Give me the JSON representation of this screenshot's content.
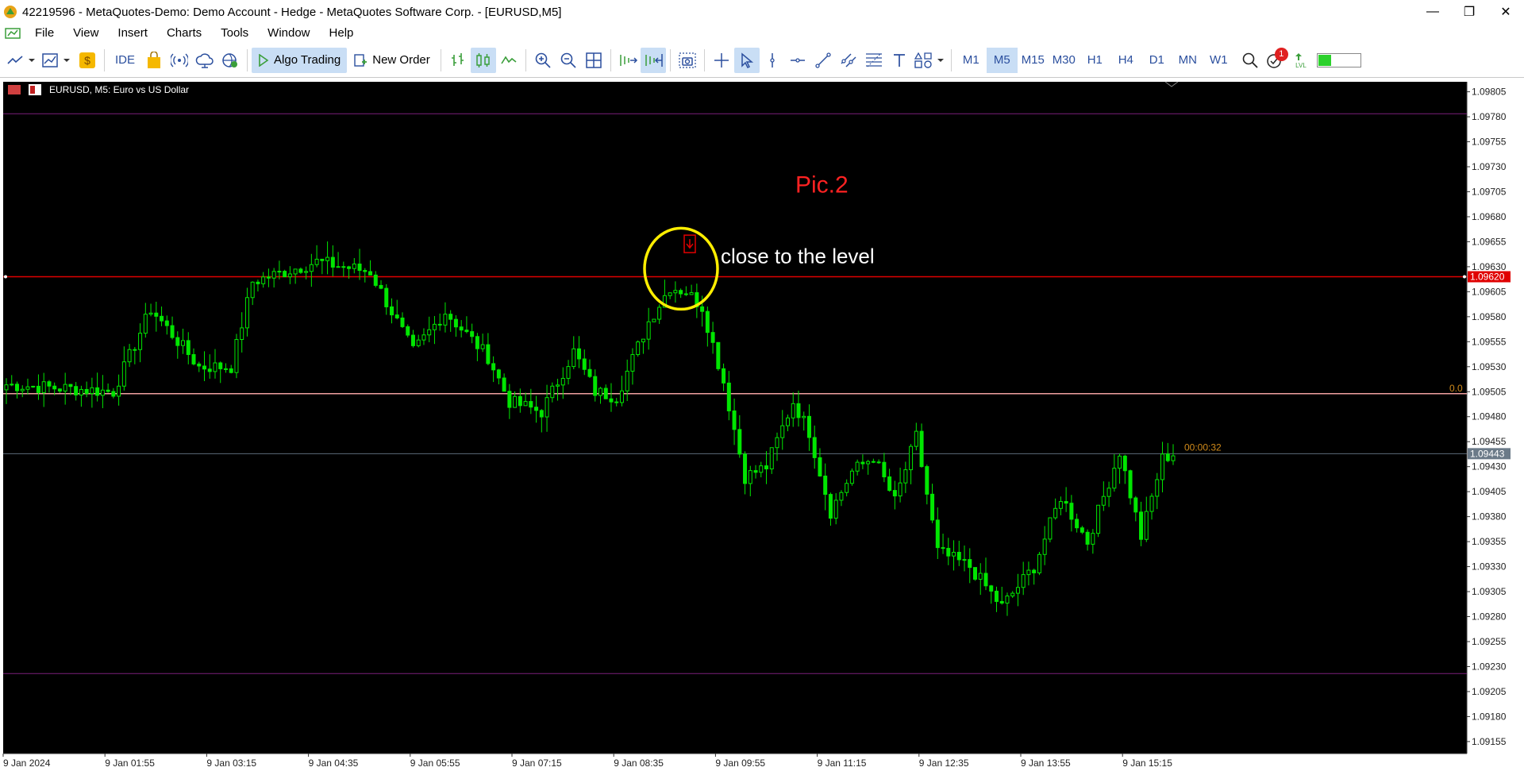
{
  "window": {
    "title": "42219596 - MetaQuotes-Demo: Demo Account - Hedge - MetaQuotes Software Corp. - [EURUSD,M5]",
    "minimize": "—",
    "maximize": "❐",
    "close": "✕"
  },
  "menu": [
    "File",
    "View",
    "Insert",
    "Charts",
    "Tools",
    "Window",
    "Help"
  ],
  "mdi": {
    "min": "—",
    "restore": "⧉",
    "close": "✕"
  },
  "toolbar": {
    "ide": "IDE",
    "algo_trading": "Algo Trading",
    "new_order": "New Order",
    "timeframes": [
      "M1",
      "M5",
      "M15",
      "M30",
      "H1",
      "H4",
      "D1",
      "MN",
      "W1"
    ],
    "active_timeframe": "M5",
    "notification_count": "1"
  },
  "chart": {
    "header": "EURUSD, M5:  Euro vs US Dollar",
    "annotation_title": "Pic.2",
    "annotation_text": "close to the level",
    "level_label": "0.0",
    "countdown": "00:00:32",
    "current_price_label": "1.09443",
    "level_price_label": "1.09620",
    "colors": {
      "background": "#000000",
      "candle": "#00e600",
      "red_level": "#e00000",
      "pink_level": "#f0a0a0",
      "purple_level": "#7a1f7a",
      "bid_line": "#5c6b7a",
      "annotation_red": "#ff2222",
      "circle": "#ffee00",
      "countdown": "#d08a1a"
    }
  },
  "chart_data": {
    "type": "candlestick",
    "symbol": "EURUSD",
    "timeframe": "M5",
    "y_ticks": [
      "1.09805",
      "1.09780",
      "1.09755",
      "1.09730",
      "1.09705",
      "1.09680",
      "1.09655",
      "1.09630",
      "1.09605",
      "1.09580",
      "1.09555",
      "1.09530",
      "1.09505",
      "1.09480",
      "1.09455",
      "1.09430",
      "1.09405",
      "1.09380",
      "1.09355",
      "1.09330",
      "1.09305",
      "1.09280",
      "1.09255",
      "1.09230",
      "1.09205",
      "1.09180",
      "1.09155"
    ],
    "ylim": [
      1.09143,
      1.09815
    ],
    "x_labels": [
      "9 Jan 2024",
      "9 Jan 01:55",
      "9 Jan 03:15",
      "9 Jan 04:35",
      "9 Jan 05:55",
      "9 Jan 07:15",
      "9 Jan 08:35",
      "9 Jan 09:55",
      "9 Jan 11:15",
      "9 Jan 12:35",
      "9 Jan 13:55",
      "9 Jan 15:15"
    ],
    "levels": {
      "red_line": 1.0962,
      "pink_line": 1.09503,
      "bid": 1.09443,
      "purple_top": 1.09783,
      "purple_bottom": 1.09223
    },
    "waypoints": [
      {
        "bar": 0,
        "price": 1.09512
      },
      {
        "bar": 12,
        "price": 1.09508
      },
      {
        "bar": 20,
        "price": 1.09505
      },
      {
        "bar": 27,
        "price": 1.09588
      },
      {
        "bar": 36,
        "price": 1.0953
      },
      {
        "bar": 42,
        "price": 1.0953
      },
      {
        "bar": 46,
        "price": 1.09615
      },
      {
        "bar": 58,
        "price": 1.09635
      },
      {
        "bar": 68,
        "price": 1.09625
      },
      {
        "bar": 76,
        "price": 1.09545
      },
      {
        "bar": 82,
        "price": 1.09585
      },
      {
        "bar": 90,
        "price": 1.0954
      },
      {
        "bar": 94,
        "price": 1.09495
      },
      {
        "bar": 100,
        "price": 1.09485
      },
      {
        "bar": 106,
        "price": 1.09545
      },
      {
        "bar": 110,
        "price": 1.09505
      },
      {
        "bar": 114,
        "price": 1.095
      },
      {
        "bar": 120,
        "price": 1.09575
      },
      {
        "bar": 124,
        "price": 1.0961
      },
      {
        "bar": 127,
        "price": 1.09605
      },
      {
        "bar": 130,
        "price": 1.0959
      },
      {
        "bar": 134,
        "price": 1.09515
      },
      {
        "bar": 138,
        "price": 1.0942
      },
      {
        "bar": 142,
        "price": 1.0943
      },
      {
        "bar": 147,
        "price": 1.09495
      },
      {
        "bar": 150,
        "price": 1.09465
      },
      {
        "bar": 154,
        "price": 1.09385
      },
      {
        "bar": 158,
        "price": 1.09425
      },
      {
        "bar": 162,
        "price": 1.0944
      },
      {
        "bar": 166,
        "price": 1.09395
      },
      {
        "bar": 170,
        "price": 1.0946
      },
      {
        "bar": 174,
        "price": 1.09345
      },
      {
        "bar": 180,
        "price": 1.0933
      },
      {
        "bar": 186,
        "price": 1.0929
      },
      {
        "bar": 192,
        "price": 1.0933
      },
      {
        "bar": 197,
        "price": 1.094
      },
      {
        "bar": 202,
        "price": 1.09355
      },
      {
        "bar": 208,
        "price": 1.09445
      },
      {
        "bar": 212,
        "price": 1.0936
      },
      {
        "bar": 216,
        "price": 1.09438
      },
      {
        "bar": 218,
        "price": 1.09443
      }
    ]
  }
}
